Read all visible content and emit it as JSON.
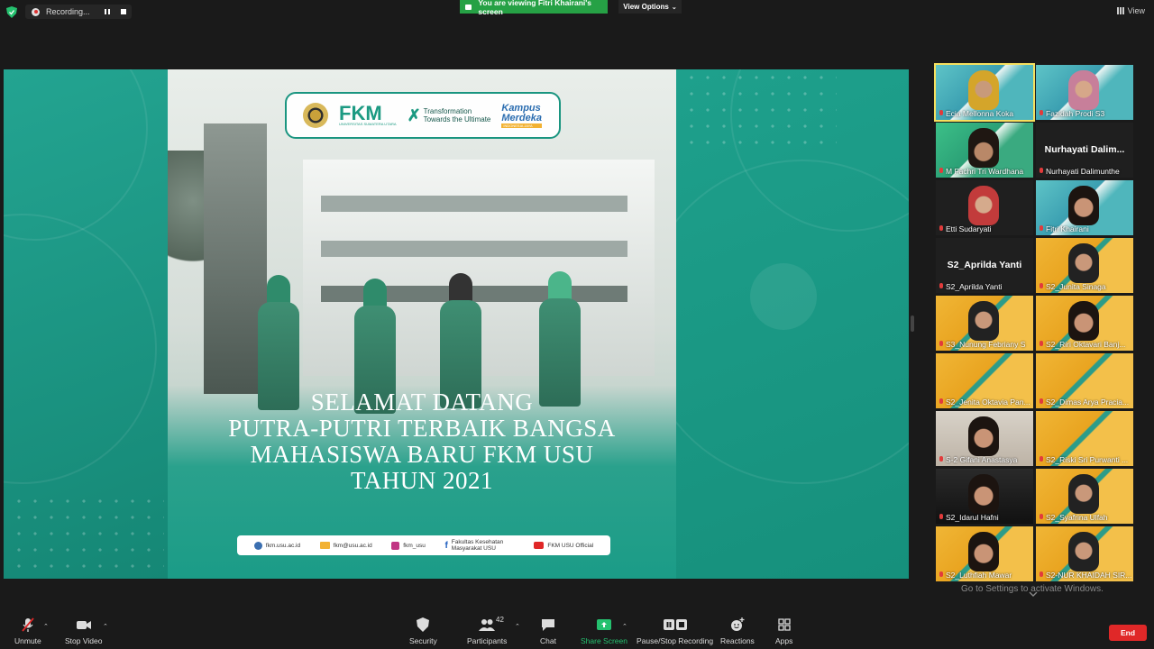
{
  "topbar": {
    "recording_label": "Recording...",
    "viewing_banner": "You are viewing Fitri Khairani's screen",
    "view_options": "View Options",
    "view_button": "View"
  },
  "shared_screen": {
    "brand": "FKM",
    "brand_sub": "UNIVERSITAS SUMATERA UTARA",
    "tagline_1": "Transformation",
    "tagline_2": "Towards the Ultimate",
    "kampus_1": "Kampus",
    "kampus_2": "Merdeka",
    "kampus_3": "INDONESIA JAYA",
    "welcome_lines": [
      "SELAMAT DATANG",
      "PUTRA-PUTRI TERBAIK BANGSA",
      "MAHASISWA BARU FKM USU",
      "TAHUN 2021"
    ],
    "contacts": [
      {
        "text": "fkm.usu.ac.id",
        "color": "#3b6fb0"
      },
      {
        "text": "fkm@usu.ac.id",
        "color": "#f2b233"
      },
      {
        "text": "fkm_usu",
        "color": "#c13584"
      },
      {
        "text": "Fakultas Kesehatan Masyarakat USU",
        "color": "#1f5fbf"
      },
      {
        "text": "FKM USU Official",
        "color": "#e02727"
      }
    ]
  },
  "participants": [
    {
      "name": "Ecia Mellonna Koka",
      "style": "slide2",
      "face": "hijab-y",
      "active": true
    },
    {
      "name": "Fazidah Prodi S3",
      "style": "slide2",
      "face": "hijab-p"
    },
    {
      "name": "M Fachri Tri Wardhana",
      "style": "slide3",
      "face": "man"
    },
    {
      "name": "Nurhayati Dalimunthe",
      "style": "plain",
      "big": "Nurhayati  Dalim..."
    },
    {
      "name": "Etti Sudaryati",
      "style": "plain",
      "face": "hijab-r"
    },
    {
      "name": "Fitri Khairani",
      "style": "slide2",
      "face": "hair"
    },
    {
      "name": "S2_Aprilda Yanti",
      "style": "plain",
      "big": "S2_Aprilda Yanti"
    },
    {
      "name": "S2_Junita Sinaga",
      "style": "slide",
      "face": "hijab-k"
    },
    {
      "name": "S3_Nunung Febriany S",
      "style": "slide",
      "face": "hijab-k"
    },
    {
      "name": "S2_Riri Oktavari Banj...",
      "style": "slide",
      "face": "hair"
    },
    {
      "name": "S2_Jenita Oktavia Pan...",
      "style": "slide"
    },
    {
      "name": "S2_Dimas Arya Pracia...",
      "style": "slide"
    },
    {
      "name": "S-2 Gifani Anastasya",
      "style": "room",
      "face": "hair"
    },
    {
      "name": "S2_Riski Sri Purwanti ...",
      "style": "slide"
    },
    {
      "name": "S2_Idarul Hafni",
      "style": "dark",
      "face": "hair"
    },
    {
      "name": "S2_Syafrina Ulfah",
      "style": "slide",
      "face": "hijab-k"
    },
    {
      "name": "S2_Luthfiah Mawar",
      "style": "slide",
      "face": "hair"
    },
    {
      "name": "S2-NUR KHAIDAH SIR...",
      "style": "slide",
      "face": "hijab-k"
    }
  ],
  "activate_text": "Go to Settings to activate Windows.",
  "toolbar": {
    "unmute": "Unmute",
    "stop_video": "Stop Video",
    "security": "Security",
    "participants": "Participants",
    "participants_count": "42",
    "chat": "Chat",
    "share_screen": "Share Screen",
    "recording": "Pause/Stop Recording",
    "reactions": "Reactions",
    "apps": "Apps",
    "end": "End"
  }
}
